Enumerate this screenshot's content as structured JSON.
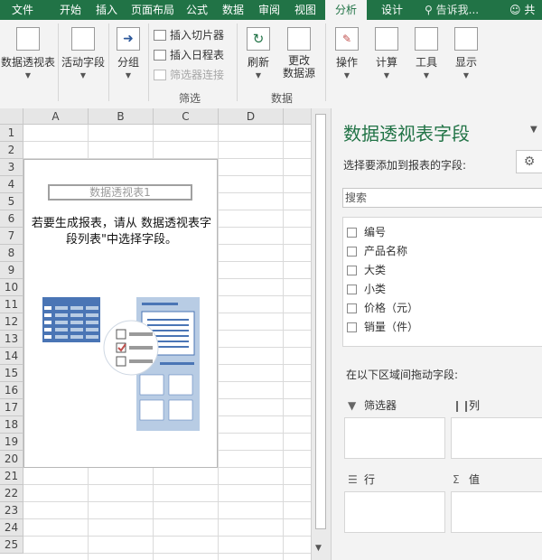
{
  "tabs": [
    {
      "id": "file",
      "label": "文件"
    },
    {
      "id": "home",
      "label": "开始"
    },
    {
      "id": "insert",
      "label": "插入"
    },
    {
      "id": "layout",
      "label": "页面布局"
    },
    {
      "id": "formulas",
      "label": "公式"
    },
    {
      "id": "data",
      "label": "数据"
    },
    {
      "id": "review",
      "label": "审阅"
    },
    {
      "id": "view",
      "label": "视图"
    },
    {
      "id": "analyze",
      "label": "分析",
      "active": true
    },
    {
      "id": "design",
      "label": "设计"
    }
  ],
  "tell_me": "告诉我...",
  "share": "共享",
  "ribbon": {
    "pivot_table": "数据透视表",
    "active_field": "活动字段",
    "group": "分组",
    "insert_slicer": "插入切片器",
    "insert_timeline": "插入日程表",
    "filter_connections": "筛选器连接",
    "filter_group": "筛选",
    "refresh": "刷新",
    "change_source_1": "更改",
    "change_source_2": "数据源",
    "data_group": "数据",
    "actions": "操作",
    "calculations": "计算",
    "tools": "工具",
    "show": "显示"
  },
  "sheet": {
    "columns": [
      "A",
      "B",
      "C",
      "D"
    ],
    "rows": [
      "1",
      "2",
      "3",
      "4",
      "5",
      "6",
      "7",
      "8",
      "9",
      "10",
      "11",
      "12",
      "13",
      "14",
      "15",
      "16",
      "17",
      "18",
      "19",
      "20",
      "21",
      "22",
      "23",
      "24",
      "25"
    ],
    "pivot_name": "数据透视表1",
    "pivot_message": "若要生成报表，请从 数据透视表字段列表\"中选择字段。"
  },
  "pane": {
    "title": "数据透视表字段",
    "subtitle": "选择要添加到报表的字段:",
    "search_placeholder": "搜索",
    "fields": [
      "编号",
      "产品名称",
      "大类",
      "小类",
      "价格（元）",
      "销量（件）"
    ],
    "drag_label": "在以下区域间拖动字段:",
    "areas": {
      "filters": "筛选器",
      "columns": "列",
      "rows": "行",
      "values": "值"
    }
  },
  "colors": {
    "accent": "#217346",
    "ribbon_bg": "#f3f3f3",
    "pane_bg": "#f3f3f3",
    "pivot_icon_blue": "#4a75b5",
    "pivot_icon_light": "#b8cce4",
    "check_red": "#c0504d"
  }
}
